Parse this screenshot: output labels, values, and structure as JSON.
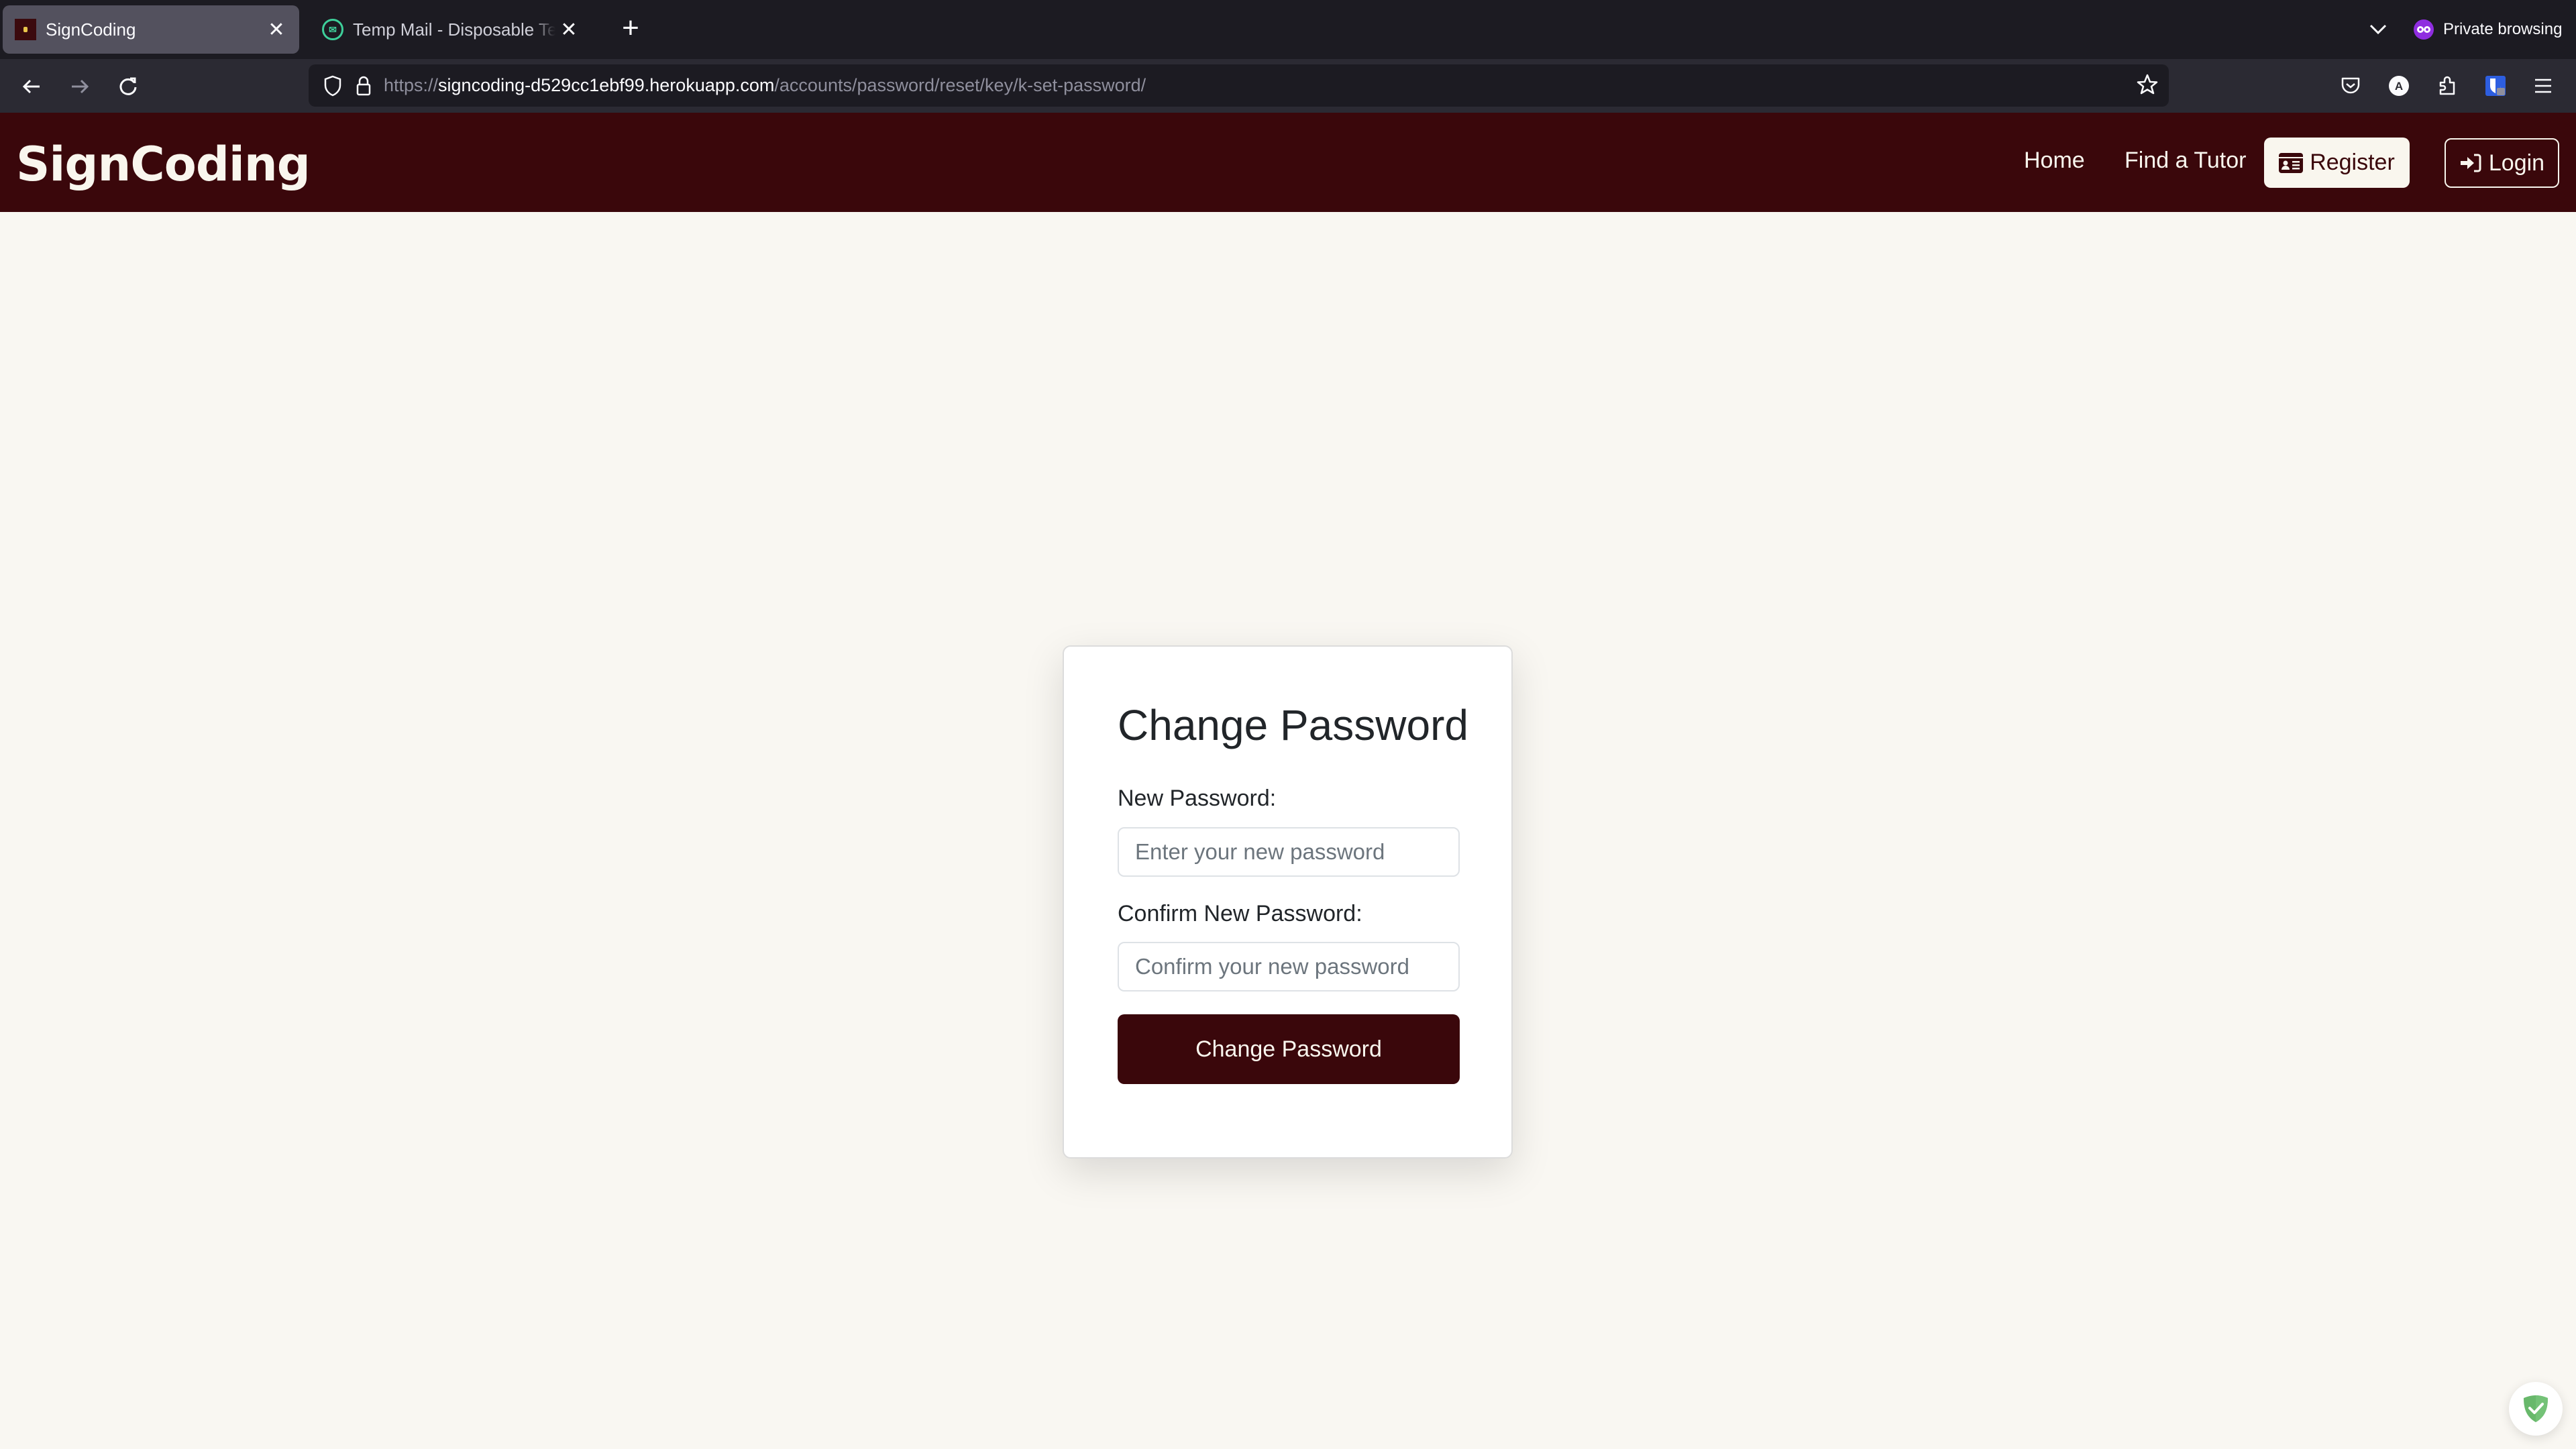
{
  "browser": {
    "tabs": [
      {
        "title": "SignCoding",
        "active": true,
        "close_icon": "close-icon"
      },
      {
        "title": "Temp Mail - Disposable Temporary Email",
        "active": false,
        "close_icon": "close-icon"
      }
    ],
    "new_tab_icon": "plus-icon",
    "private_browsing_label": "Private browsing",
    "url": {
      "scheme": "https://",
      "host": "signcoding-d529cc1ebf99.herokuapp.com",
      "path": "/accounts/password/reset/key/k-set-password/"
    }
  },
  "site": {
    "brand": "SignCoding",
    "nav": {
      "home": "Home",
      "find_tutor": "Find a Tutor",
      "register": "Register",
      "login": "Login"
    },
    "colors": {
      "primary": "#3a070b",
      "cream": "#f9f6ee",
      "background": "#f9f7f2"
    }
  },
  "form": {
    "title": "Change Password",
    "new_password_label": "New Password:",
    "new_password_placeholder": "Enter your new password",
    "new_password_value": "",
    "confirm_password_label": "Confirm New Password:",
    "confirm_password_placeholder": "Confirm your new password",
    "confirm_password_value": "",
    "submit_label": "Change Password"
  }
}
